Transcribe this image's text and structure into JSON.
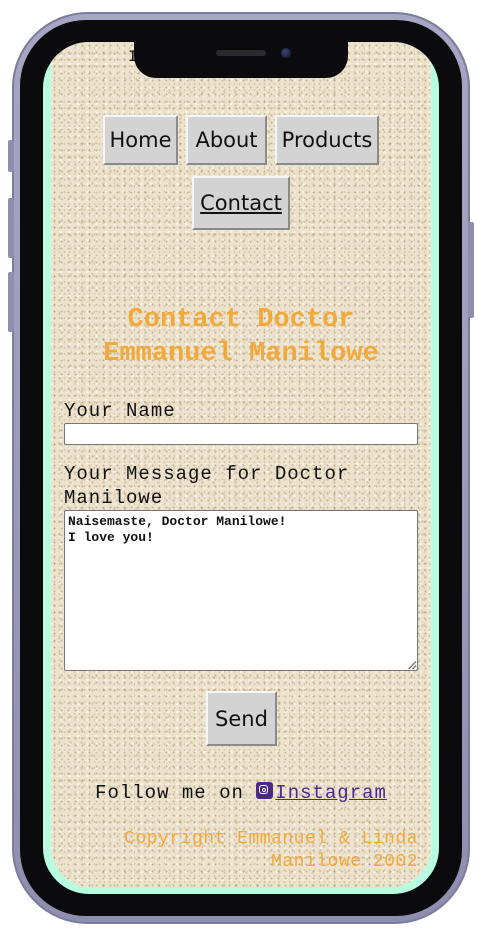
{
  "nav": {
    "items": [
      {
        "label": "Home"
      },
      {
        "label": "About"
      },
      {
        "label": "Products"
      },
      {
        "label": "Contact"
      }
    ],
    "active": "Contact"
  },
  "header": {
    "title_line1": "Contact Doctor",
    "title_line2": "Emmanuel Manilowe"
  },
  "form": {
    "name_label": "Your Name",
    "name_value": "",
    "message_label_line1": "Your Message for Doctor",
    "message_label_line2": "Manilowe",
    "message_line1": "Naisemaste, Doctor Manilowe!",
    "message_line2": "I love you!",
    "send_label": "Send"
  },
  "footer": {
    "follow_text": "Follow me on ",
    "instagram_label": "Instagram",
    "copyright_line1": "Copyright Emmanuel & Linda",
    "copyright_line2": "Manilowe 2002"
  },
  "colors": {
    "heading": "#f2a93b",
    "link": "#4b2a86",
    "phone_frame": "#a7a6c4",
    "screen_edge": "#b7fbe0"
  },
  "icons": {
    "instagram": "instagram-icon"
  }
}
